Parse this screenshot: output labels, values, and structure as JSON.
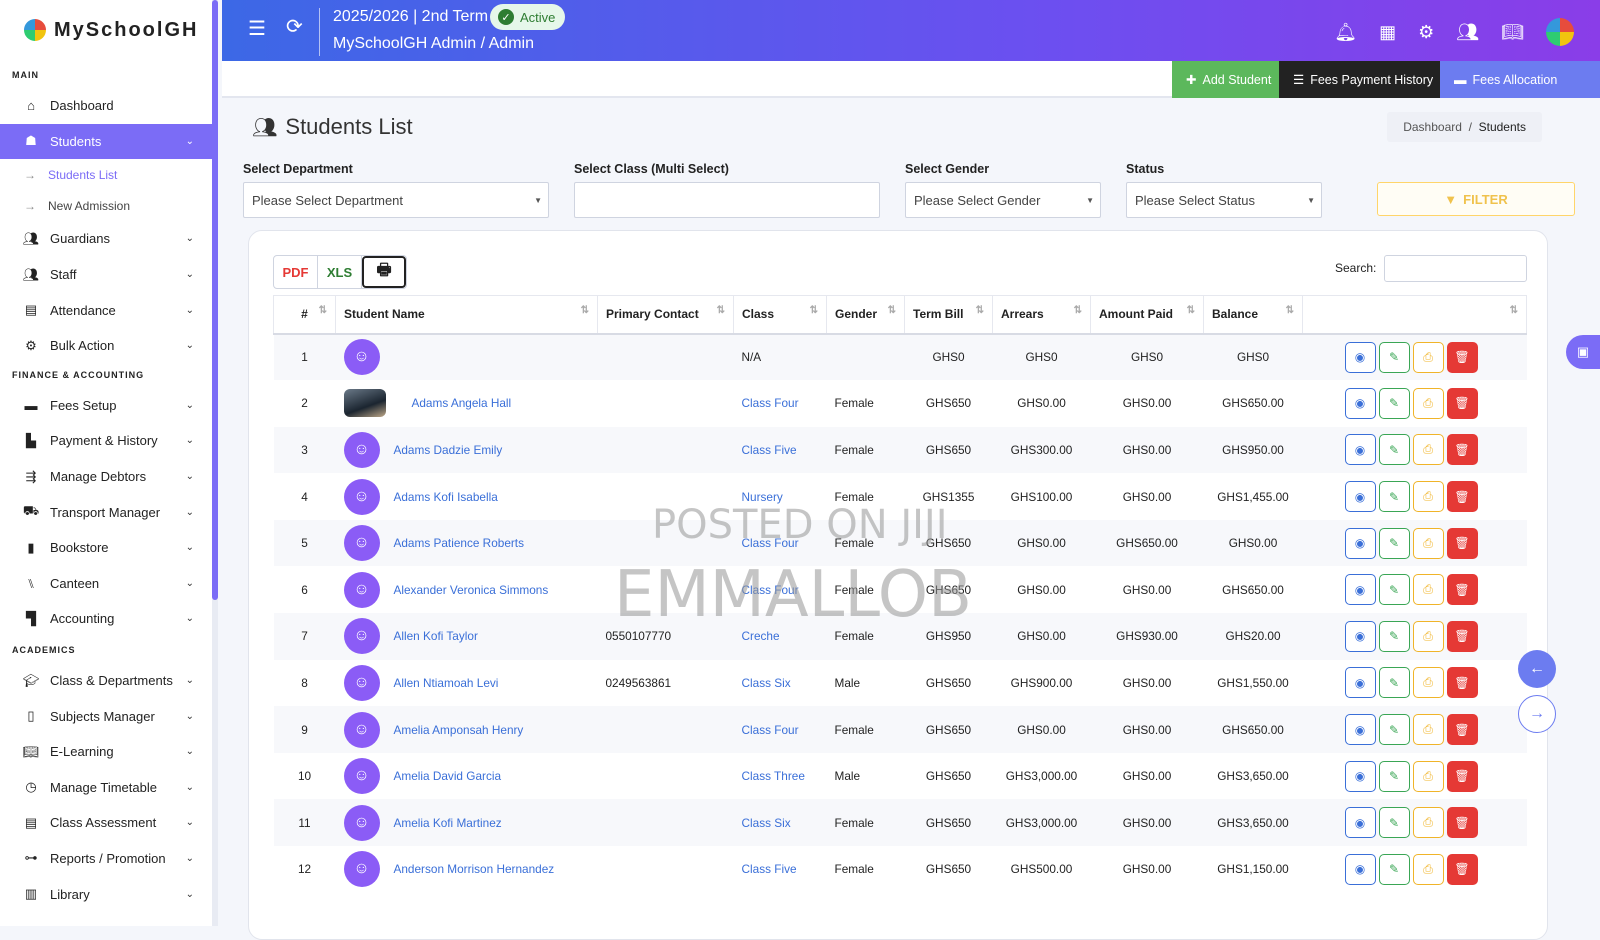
{
  "app": {
    "brand": "MySchoolGH"
  },
  "sidebar": {
    "sections": {
      "main": "MAIN",
      "finance": "FINANCE & ACCOUNTING",
      "academics": "ACADEMICS"
    },
    "main_items": [
      {
        "label": "Dashboard",
        "icon": "home-icon"
      },
      {
        "label": "Students",
        "icon": "student-icon"
      },
      {
        "label": "Guardians",
        "icon": "guardian-icon"
      },
      {
        "label": "Staff",
        "icon": "staff-icon"
      },
      {
        "label": "Attendance",
        "icon": "attendance-icon"
      },
      {
        "label": "Bulk Action",
        "icon": "gear-icon"
      }
    ],
    "students_sub": [
      {
        "label": "Students List"
      },
      {
        "label": "New Admission"
      }
    ],
    "finance_items": [
      {
        "label": "Fees Setup"
      },
      {
        "label": "Payment & History"
      },
      {
        "label": "Manage Debtors"
      },
      {
        "label": "Transport Manager"
      },
      {
        "label": "Bookstore"
      },
      {
        "label": "Canteen"
      },
      {
        "label": "Accounting"
      }
    ],
    "academics_items": [
      {
        "label": "Class & Departments"
      },
      {
        "label": "Subjects Manager"
      },
      {
        "label": "E-Learning"
      },
      {
        "label": "Manage Timetable"
      },
      {
        "label": "Class Assessment"
      },
      {
        "label": "Reports / Promotion"
      },
      {
        "label": "Library"
      }
    ]
  },
  "topbar": {
    "term": "2025/2026 | 2nd Term",
    "status": "Active",
    "user": "MySchoolGH Admin / Admin"
  },
  "actions": {
    "add_student": "Add Student",
    "fees_history": "Fees Payment History",
    "fees_allocation": "Fees Allocation"
  },
  "page": {
    "title": "Students List",
    "breadcrumb": {
      "home": "Dashboard",
      "sep": "/",
      "current": "Students"
    }
  },
  "filters": {
    "department_label": "Select Department",
    "department_value": "Please Select Department",
    "class_label": "Select Class (Multi Select)",
    "gender_label": "Select Gender",
    "gender_value": "Please Select Gender",
    "status_label": "Status",
    "status_value": "Please Select Status",
    "filter_button": "FILTER"
  },
  "table": {
    "search_label": "Search:",
    "columns": [
      "#",
      "Student Name",
      "Primary Contact",
      "Class",
      "Gender",
      "Term Bill",
      "Arrears",
      "Amount Paid",
      "Balance",
      ""
    ],
    "rows": [
      {
        "n": "1",
        "name": "",
        "contact": "",
        "class": "N/A",
        "gender": "",
        "bill": "GHS0",
        "arrears": "GHS0",
        "paid": "GHS0",
        "balance": "GHS0"
      },
      {
        "n": "2",
        "name": "Adams Angela Hall",
        "contact": "",
        "class": "Class Four",
        "gender": "Female",
        "bill": "GHS650",
        "arrears": "GHS0.00",
        "paid": "GHS0.00",
        "balance": "GHS650.00"
      },
      {
        "n": "3",
        "name": "Adams Dadzie Emily",
        "contact": "",
        "class": "Class Five",
        "gender": "Female",
        "bill": "GHS650",
        "arrears": "GHS300.00",
        "paid": "GHS0.00",
        "balance": "GHS950.00"
      },
      {
        "n": "4",
        "name": "Adams Kofi Isabella",
        "contact": "",
        "class": "Nursery",
        "gender": "Female",
        "bill": "GHS1355",
        "arrears": "GHS100.00",
        "paid": "GHS0.00",
        "balance": "GHS1,455.00"
      },
      {
        "n": "5",
        "name": "Adams Patience Roberts",
        "contact": "",
        "class": "Class Four",
        "gender": "Female",
        "bill": "GHS650",
        "arrears": "GHS0.00",
        "paid": "GHS650.00",
        "balance": "GHS0.00"
      },
      {
        "n": "6",
        "name": "Alexander Veronica Simmons",
        "contact": "",
        "class": "Class Four",
        "gender": "Female",
        "bill": "GHS650",
        "arrears": "GHS0.00",
        "paid": "GHS0.00",
        "balance": "GHS650.00"
      },
      {
        "n": "7",
        "name": "Allen Kofi Taylor",
        "contact": "0550107770",
        "class": "Creche",
        "gender": "Female",
        "bill": "GHS950",
        "arrears": "GHS0.00",
        "paid": "GHS930.00",
        "balance": "GHS20.00"
      },
      {
        "n": "8",
        "name": "Allen Ntiamoah Levi",
        "contact": "0249563861",
        "class": "Class Six",
        "gender": "Male",
        "bill": "GHS650",
        "arrears": "GHS900.00",
        "paid": "GHS0.00",
        "balance": "GHS1,550.00"
      },
      {
        "n": "9",
        "name": "Amelia Amponsah Henry",
        "contact": "",
        "class": "Class Four",
        "gender": "Female",
        "bill": "GHS650",
        "arrears": "GHS0.00",
        "paid": "GHS0.00",
        "balance": "GHS650.00"
      },
      {
        "n": "10",
        "name": "Amelia David Garcia",
        "contact": "",
        "class": "Class Three",
        "gender": "Male",
        "bill": "GHS650",
        "arrears": "GHS3,000.00",
        "paid": "GHS0.00",
        "balance": "GHS3,650.00"
      },
      {
        "n": "11",
        "name": "Amelia Kofi Martinez",
        "contact": "",
        "class": "Class Six",
        "gender": "Female",
        "bill": "GHS650",
        "arrears": "GHS3,000.00",
        "paid": "GHS0.00",
        "balance": "GHS3,650.00"
      },
      {
        "n": "12",
        "name": "Anderson Morrison Hernandez",
        "contact": "",
        "class": "Class Five",
        "gender": "Female",
        "bill": "GHS650",
        "arrears": "GHS500.00",
        "paid": "GHS0.00",
        "balance": "GHS1,150.00"
      }
    ]
  },
  "watermark": {
    "line1": "POSTED ON JIJI",
    "line2": "EMMALLOB"
  },
  "colors": {
    "accent": "#7b6cf6",
    "link": "#3a6fd8",
    "success": "#5cb85c",
    "danger": "#e53935",
    "warning": "#f0b429"
  }
}
